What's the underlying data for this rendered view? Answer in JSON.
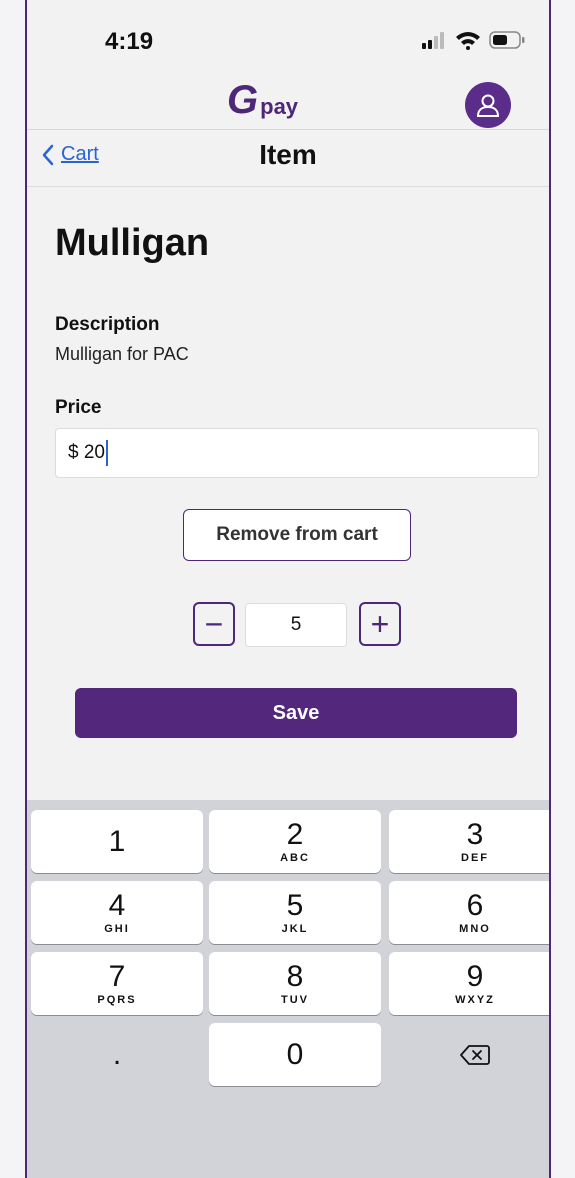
{
  "status_bar": {
    "time": "4:19"
  },
  "header": {
    "logo_g": "G",
    "logo_pay": "pay"
  },
  "nav": {
    "back_label": "Cart",
    "title": "Item"
  },
  "item": {
    "name": "Mulligan",
    "description_label": "Description",
    "description": "Mulligan for PAC",
    "price_label": "Price",
    "price_value": "$ 20"
  },
  "actions": {
    "remove_label": "Remove from cart",
    "save_label": "Save"
  },
  "stepper": {
    "minus": "−",
    "value": "5",
    "plus": "+"
  },
  "keyboard": {
    "keys": [
      {
        "num": "1",
        "letters": ""
      },
      {
        "num": "2",
        "letters": "ABC"
      },
      {
        "num": "3",
        "letters": "DEF"
      },
      {
        "num": "4",
        "letters": "GHI"
      },
      {
        "num": "5",
        "letters": "JKL"
      },
      {
        "num": "6",
        "letters": "MNO"
      },
      {
        "num": "7",
        "letters": "PQRS"
      },
      {
        "num": "8",
        "letters": "TUV"
      },
      {
        "num": "9",
        "letters": "WXYZ"
      },
      {
        "num": ".",
        "letters": ""
      },
      {
        "num": "0",
        "letters": ""
      }
    ]
  },
  "colors": {
    "brand": "#52277c",
    "link": "#2a63d4",
    "keyboard_bg": "#d1d3d9"
  },
  "icons": [
    "cellular-signal-icon",
    "wifi-icon",
    "battery-icon",
    "user-icon",
    "chevron-left-icon",
    "delete-backspace-icon"
  ]
}
